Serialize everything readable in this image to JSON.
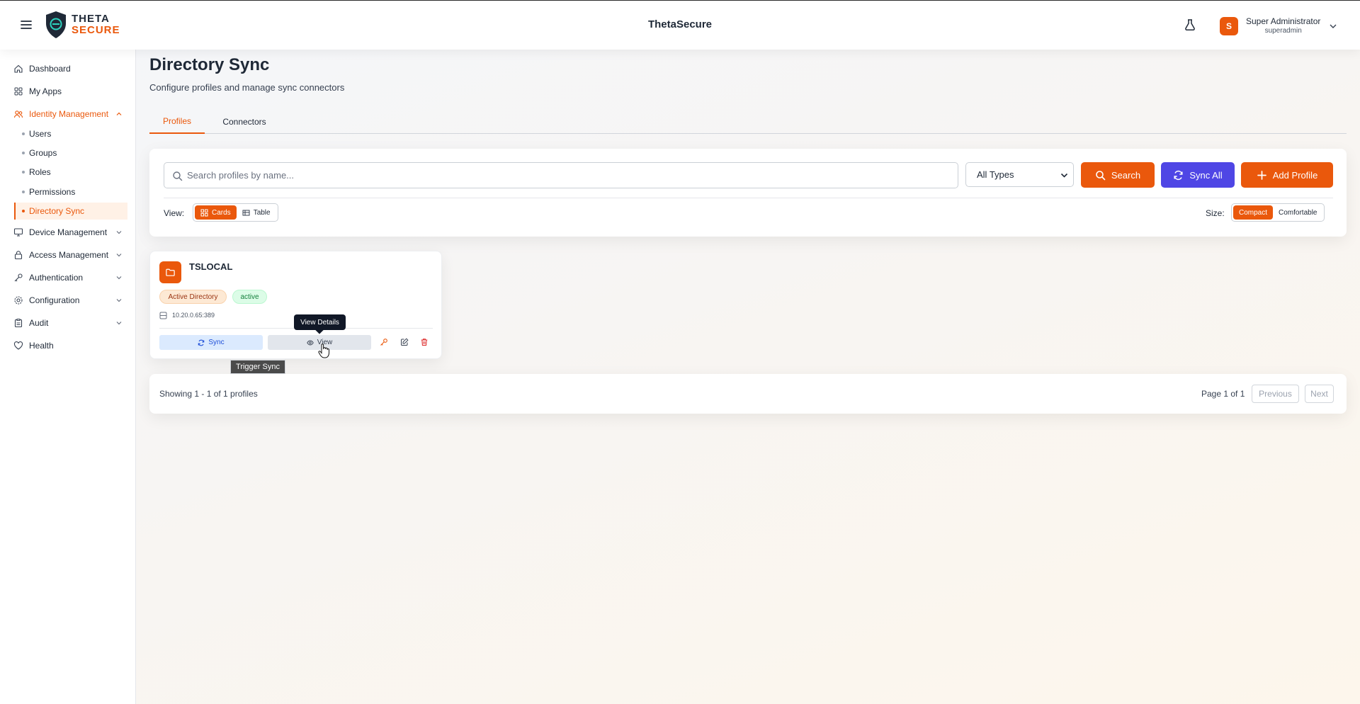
{
  "app": {
    "title": "ThetaSecure",
    "logo_line1": "THETA",
    "logo_line2": "SECURE"
  },
  "user": {
    "name": "Super Administrator",
    "role": "superadmin",
    "initial": "S"
  },
  "sidebar": {
    "items": [
      {
        "label": "Dashboard"
      },
      {
        "label": "My Apps"
      },
      {
        "label": "Identity Management",
        "expanded": true,
        "children": [
          {
            "label": "Users"
          },
          {
            "label": "Groups"
          },
          {
            "label": "Roles"
          },
          {
            "label": "Permissions"
          },
          {
            "label": "Directory Sync",
            "active": true
          }
        ]
      },
      {
        "label": "Device Management"
      },
      {
        "label": "Access Management"
      },
      {
        "label": "Authentication"
      },
      {
        "label": "Configuration"
      },
      {
        "label": "Audit"
      },
      {
        "label": "Health"
      }
    ]
  },
  "page": {
    "title": "Directory Sync",
    "subtitle": "Configure profiles and manage sync connectors",
    "tabs": [
      {
        "label": "Profiles",
        "active": true
      },
      {
        "label": "Connectors"
      }
    ]
  },
  "toolbar": {
    "search_placeholder": "Search profiles by name...",
    "search_value": "",
    "type_select": "All Types",
    "search_label": "Search",
    "sync_all_label": "Sync All",
    "add_profile_label": "Add Profile",
    "view_label": "View:",
    "view_options": [
      "Cards",
      "Table"
    ],
    "size_label": "Size:",
    "size_options": [
      "Compact",
      "Comfortable"
    ]
  },
  "profiles": [
    {
      "name": "TSLOCAL",
      "type": "Active Directory",
      "status": "active",
      "host": "10.20.0.65:389",
      "sync_label": "Sync",
      "view_label": "View"
    }
  ],
  "tooltips": {
    "view": "View Details",
    "sync": "Trigger Sync"
  },
  "pagination": {
    "showing": "Showing 1 - 1 of 1 profiles",
    "page_info": "Page 1 of 1",
    "prev_label": "Previous",
    "next_label": "Next"
  },
  "colors": {
    "accent": "#ea580c",
    "sync_all": "#4f46e5",
    "status_active": "#15803d"
  },
  "icons": {
    "menu": "menu-icon",
    "flask": "flask-icon",
    "search": "search-icon",
    "sync": "sync-icon",
    "add": "plus-icon",
    "folder": "folder-icon",
    "server": "server-icon",
    "view": "eye-icon",
    "key": "key-icon",
    "edit": "edit-icon",
    "delete": "trash-icon"
  }
}
